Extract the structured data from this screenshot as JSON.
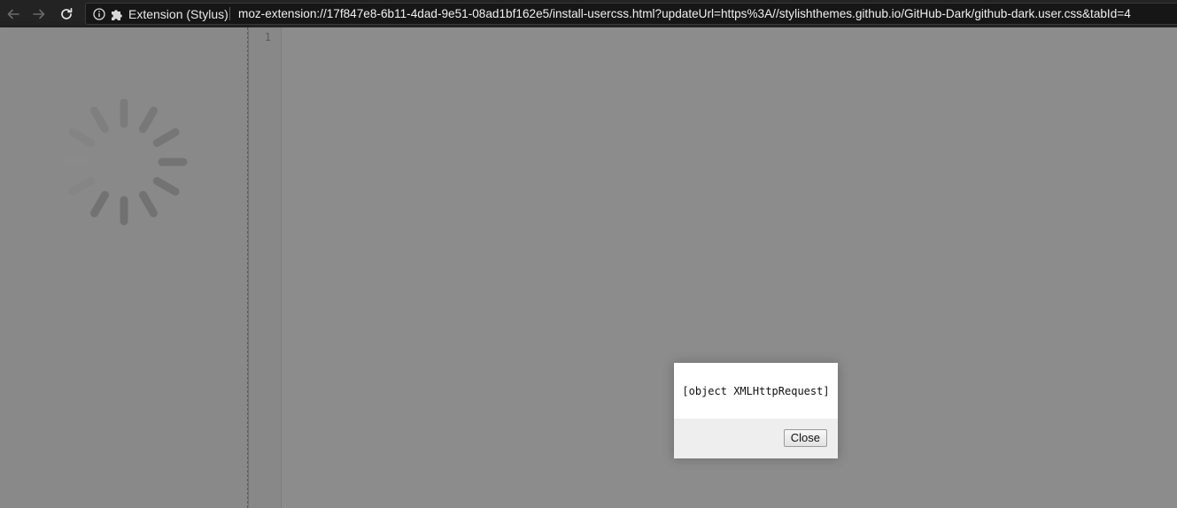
{
  "browser": {
    "back_icon": "arrow-left-icon",
    "forward_icon": "arrow-right-icon",
    "reload_icon": "reload-icon",
    "identity": {
      "info_icon": "info-icon",
      "extension_icon": "puzzle-piece-icon",
      "label": "Extension (Stylus)"
    },
    "url": "moz-extension://17f847e8-6b11-4dad-9e51-08ad1bf162e5/install-usercss.html?updateUrl=https%3A//stylishthemes.github.io/GitHub-Dark/github-dark.user.css&tabId=4"
  },
  "sidebar": {
    "spinner_icon": "loading-spinner-icon"
  },
  "editor": {
    "line_numbers": [
      "1"
    ]
  },
  "dialog": {
    "message": "[object XMLHttpRequest]",
    "close_label": "Close"
  },
  "colors": {
    "toolbar_bg": "#232323",
    "overlay_bg": "#8c8c8c",
    "dialog_bg": "#ffffff",
    "dialog_footer_bg": "#eeeeee"
  }
}
